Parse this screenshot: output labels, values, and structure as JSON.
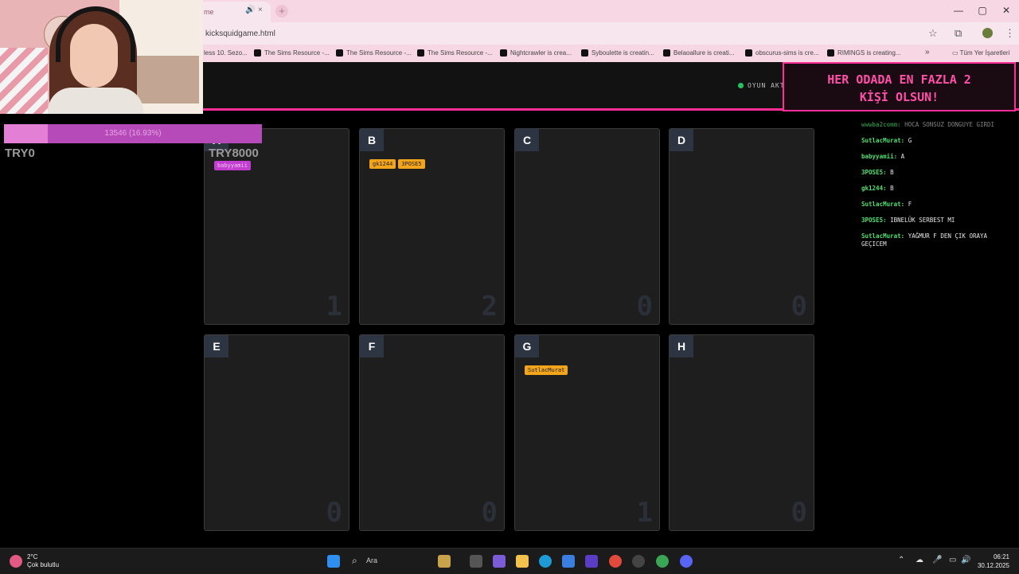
{
  "browser": {
    "tab_title": "me",
    "tab_mute_icon": "speaker-icon",
    "tab_close": "×",
    "new_tab": "+",
    "url": "kicksquidgame.html",
    "window_controls": [
      "—",
      "▢",
      "✕"
    ],
    "bookmarks": [
      "less 10. Sezo...",
      "The Sims Resource -...",
      "The Sims Resource -...",
      "The Sims Resource -...",
      "Nightcrawler is crea...",
      "Syboulette is creatin...",
      "Belaoallure is creati...",
      "obscurus-sims is cre...",
      "RIMINGS is creating..."
    ],
    "bookmarks_overflow": "»",
    "all_bookmarks": "Tüm Yer İşaretleri"
  },
  "game": {
    "status": "OYUN AKT",
    "notice_line1": "HER ODADA EN FAZLA 2",
    "notice_line2": "KİŞİ OLSUN!",
    "rooms": [
      {
        "letter": "A",
        "count": "1",
        "players": [
          "babyyamii"
        ]
      },
      {
        "letter": "B",
        "count": "2",
        "players": [
          "gk1244",
          "3POSE5"
        ]
      },
      {
        "letter": "C",
        "count": "0",
        "players": []
      },
      {
        "letter": "D",
        "count": "0",
        "players": []
      },
      {
        "letter": "E",
        "count": "0",
        "players": []
      },
      {
        "letter": "F",
        "count": "0",
        "players": []
      },
      {
        "letter": "G",
        "count": "1",
        "players": [
          "SutlacMurat"
        ]
      },
      {
        "letter": "H",
        "count": "0",
        "players": []
      }
    ],
    "chat": [
      {
        "user": "wwwba2comm:",
        "text": "HOCA SONSUZ DONGUYE GIRDI"
      },
      {
        "user": "SutlacMurat:",
        "text": "G"
      },
      {
        "user": "babyyamii:",
        "text": "A"
      },
      {
        "user": "3POSE5:",
        "text": "B"
      },
      {
        "user": "gk1244:",
        "text": "B"
      },
      {
        "user": "SutlacMurat:",
        "text": "F"
      },
      {
        "user": "3POSE5:",
        "text": "IBNELÜK SERBEST MI"
      },
      {
        "user": "SutlacMurat:",
        "text": "YAĞMUR F DEN ÇIK ORAYA GEÇICEM"
      }
    ]
  },
  "overlay": {
    "progress_label": "13546 (16.93%)",
    "progress_fraction": 0.1693,
    "try_left": "TRY0",
    "try_right": "TRY8000"
  },
  "taskbar": {
    "temp": "2°C",
    "weather": "Çok bulutlu",
    "search": "Ara",
    "time": "06:21",
    "date": "30.12.2025"
  },
  "colors": {
    "accent": "#ff2d95",
    "tag": "#f2a41b",
    "chat_user": "#4ee070"
  }
}
